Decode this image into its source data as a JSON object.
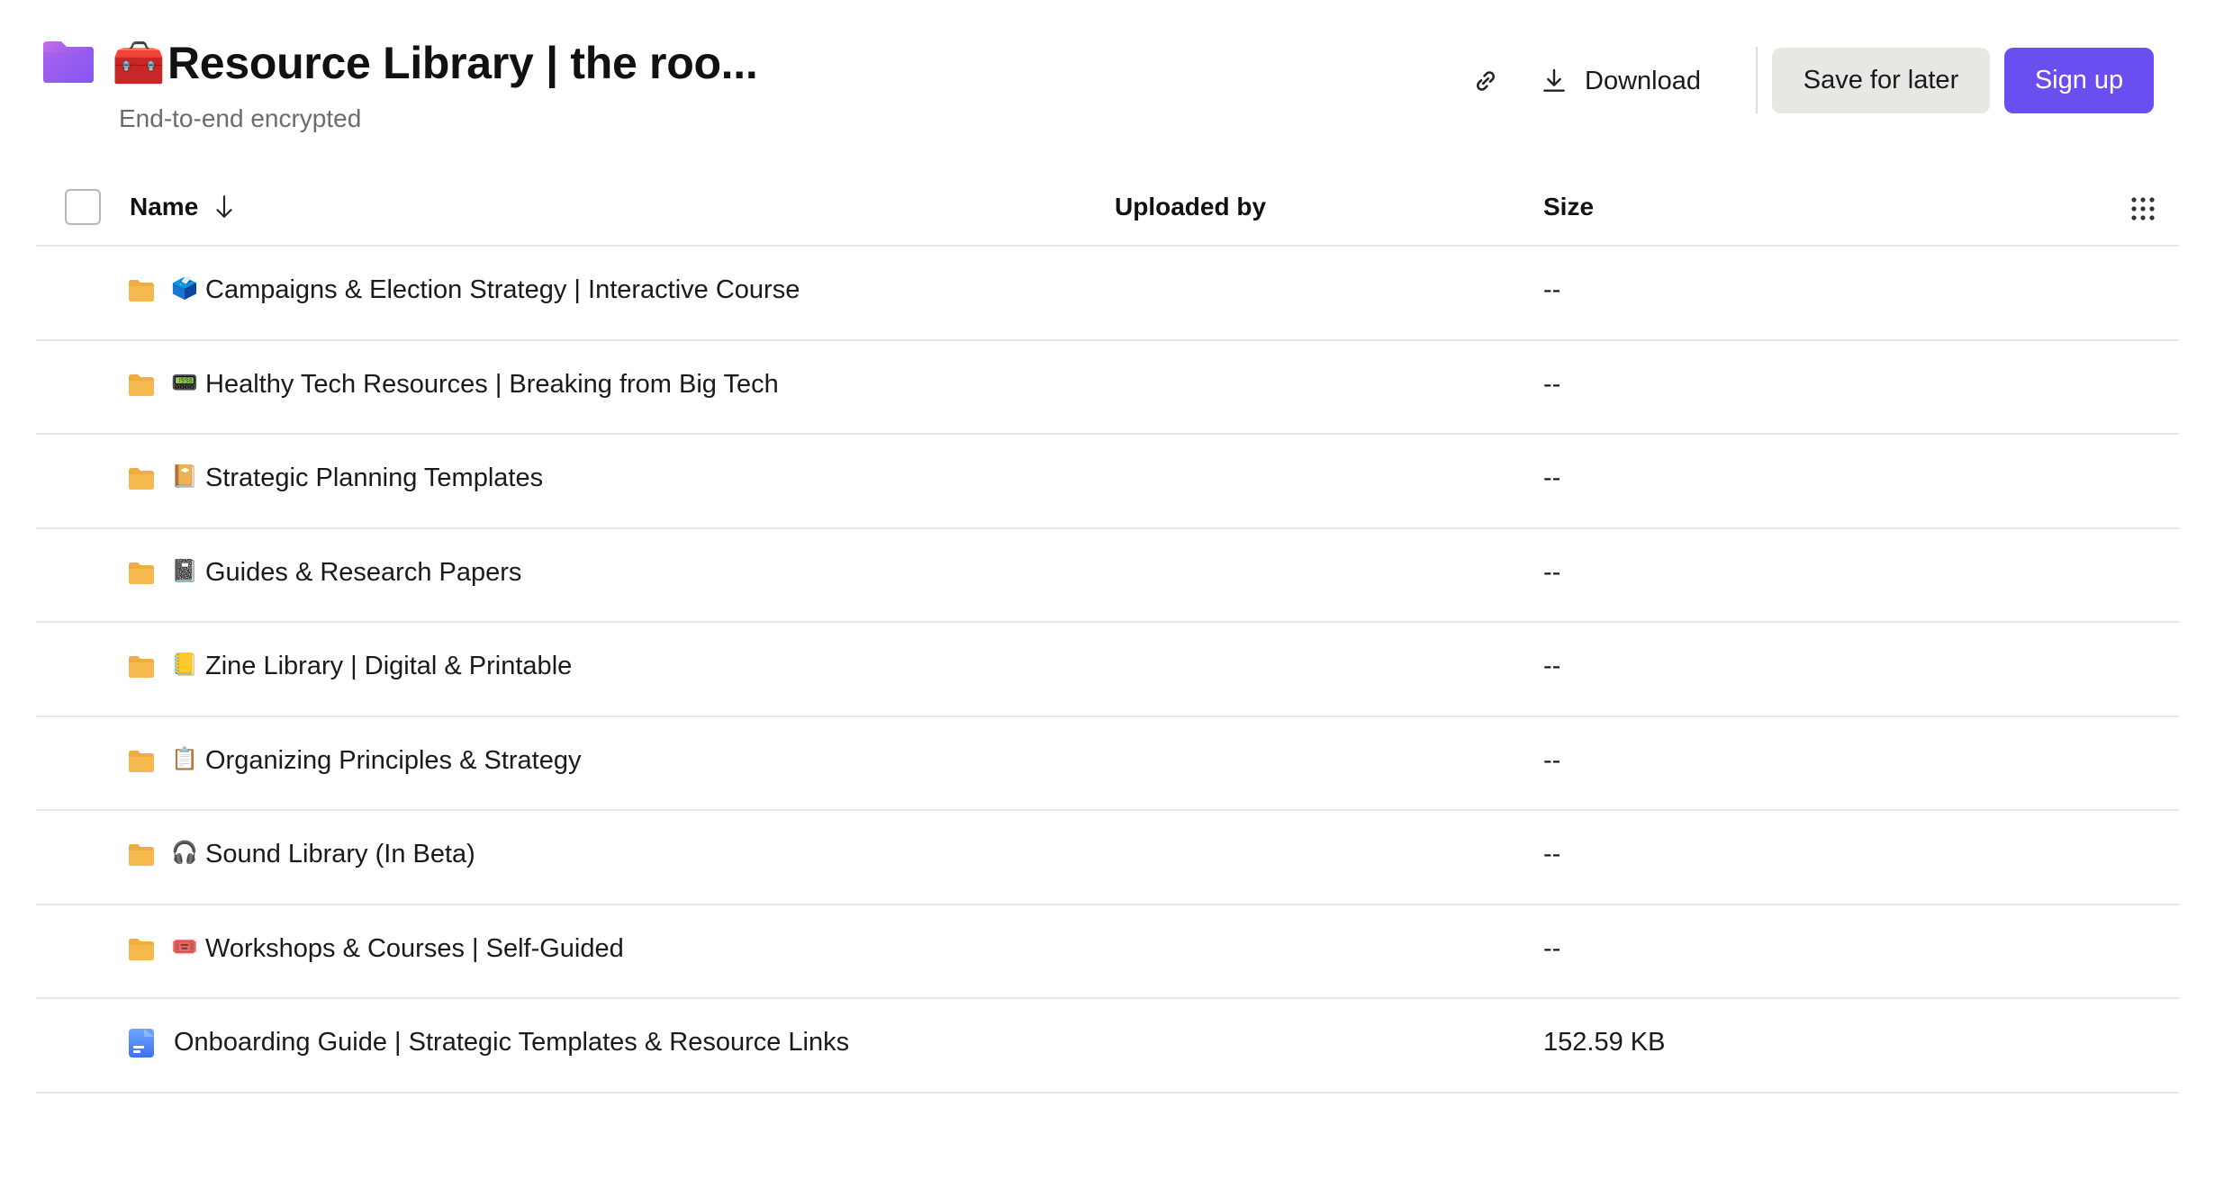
{
  "header": {
    "title_emoji": "🧰",
    "title": "Resource Library | the roo...",
    "subtitle": "End-to-end encrypted",
    "download_label": "Download",
    "save_label": "Save for later",
    "signup_label": "Sign up"
  },
  "colors": {
    "accent": "#6b4ef0",
    "folder": "#f0ad3f",
    "app_folder_top": "#c86ae8",
    "app_folder_bottom": "#6a4ff0"
  },
  "table": {
    "columns": {
      "name": "Name",
      "uploaded_by": "Uploaded by",
      "size": "Size"
    },
    "sort_icon": "arrow-down-icon",
    "rows": [
      {
        "type": "folder",
        "emoji": "🗳️",
        "name": "Campaigns & Election Strategy | Interactive Course",
        "uploaded_by": "",
        "size": "--"
      },
      {
        "type": "folder",
        "emoji": "📟",
        "name": "Healthy Tech Resources | Breaking from Big Tech",
        "uploaded_by": "",
        "size": "--"
      },
      {
        "type": "folder",
        "emoji": "📔",
        "name": "Strategic Planning Templates",
        "uploaded_by": "",
        "size": "--"
      },
      {
        "type": "folder",
        "emoji": "📓",
        "name": "Guides & Research Papers",
        "uploaded_by": "",
        "size": "--"
      },
      {
        "type": "folder",
        "emoji": "📒",
        "name": "Zine Library | Digital & Printable",
        "uploaded_by": "",
        "size": "--"
      },
      {
        "type": "folder",
        "emoji": "📋",
        "name": "Organizing Principles & Strategy",
        "uploaded_by": "",
        "size": "--"
      },
      {
        "type": "folder",
        "emoji": "🎧",
        "name": "Sound Library (In Beta)",
        "uploaded_by": "",
        "size": "--"
      },
      {
        "type": "folder",
        "emoji": "🎟️",
        "name": "Workshops & Courses | Self-Guided",
        "uploaded_by": "",
        "size": "--"
      },
      {
        "type": "document",
        "emoji": "",
        "name": "Onboarding Guide | Strategic Templates & Resource Links",
        "uploaded_by": "",
        "size": "152.59 KB"
      }
    ]
  }
}
